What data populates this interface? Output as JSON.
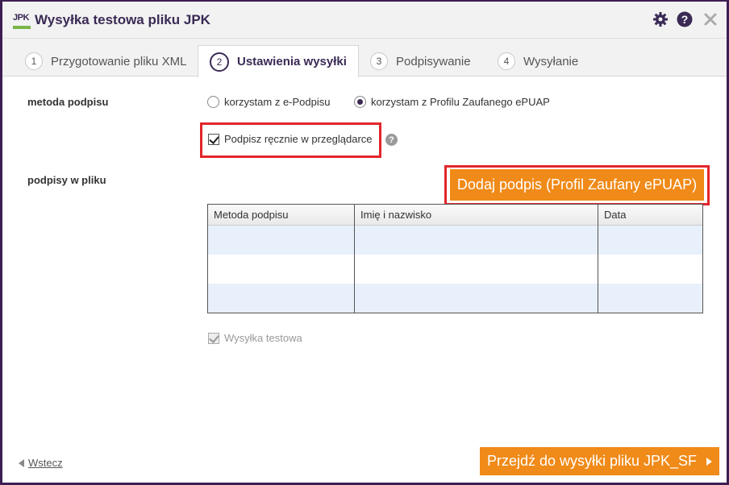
{
  "window": {
    "logo_text": "JPK",
    "title": "Wysyłka testowa pliku JPK",
    "brand_color": "#3a2a55",
    "accent_color": "#f08a18",
    "highlight_color": "#e2262b",
    "icons": [
      "gear-icon",
      "help-icon",
      "close-icon"
    ]
  },
  "tabs": [
    {
      "num": "1",
      "label": "Przygotowanie pliku XML",
      "active": false
    },
    {
      "num": "2",
      "label": "Ustawienia wysyłki",
      "active": true
    },
    {
      "num": "3",
      "label": "Podpisywanie",
      "active": false
    },
    {
      "num": "4",
      "label": "Wysyłanie",
      "active": false
    }
  ],
  "signing": {
    "method_label": "metoda podpisu",
    "options": [
      {
        "label": "korzystam z e-Podpisu",
        "selected": false
      },
      {
        "label": "korzystam z Profilu Zaufanego ePUAP",
        "selected": true
      }
    ],
    "manual_sign_label": "Podpisz ręcznie w przeglądarce",
    "manual_sign_checked": true,
    "help_glyph": "?"
  },
  "signatures": {
    "label": "podpisy w pliku",
    "add_button": "Dodaj podpis (Profil Zaufany ePUAP)",
    "columns": [
      "Metoda podpisu",
      "Imię i nazwisko",
      "Data"
    ],
    "rows": [
      [
        "",
        "",
        ""
      ],
      [
        "",
        "",
        ""
      ],
      [
        "",
        "",
        ""
      ]
    ]
  },
  "test_send": {
    "label": "Wysyłka testowa",
    "checked": true,
    "disabled": true
  },
  "footer": {
    "back_label": "Wstecz",
    "next_label": "Przejdź do wysyłki pliku JPK_SF"
  }
}
